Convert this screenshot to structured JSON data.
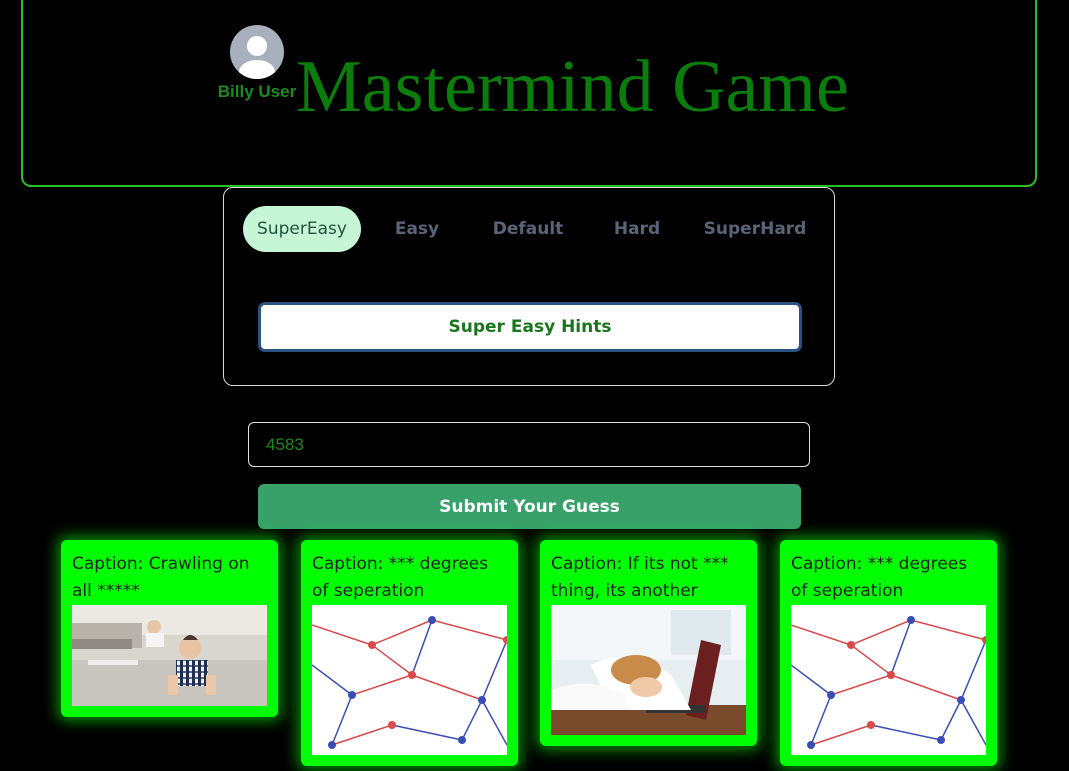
{
  "header": {
    "title": "Mastermind Game",
    "user": {
      "name": "Billy User",
      "avatar_icon": "user-avatar-icon"
    }
  },
  "difficulty": {
    "tabs": [
      {
        "label": "SuperEasy",
        "active": true
      },
      {
        "label": "Easy",
        "active": false
      },
      {
        "label": "Default",
        "active": false
      },
      {
        "label": "Hard",
        "active": false
      },
      {
        "label": "SuperHard",
        "active": false
      }
    ],
    "hints_button": "Super Easy Hints"
  },
  "guess": {
    "value": "4583",
    "submit_label": "Submit Your Guess"
  },
  "cards": [
    {
      "caption": "Caption: Crawling on all *****",
      "image": "baby-crawling-photo"
    },
    {
      "caption": "Caption: *** degrees of seperation",
      "image": "network-diagram-photo"
    },
    {
      "caption": "Caption: If its not *** thing, its another",
      "image": "tired-person-laptop-photo"
    },
    {
      "caption": "Caption: *** degrees of seperation",
      "image": "network-diagram-photo"
    }
  ],
  "colors": {
    "background": "#000000",
    "accent_green": "#00ff00",
    "title_green": "#0a7d0a",
    "submit_green": "#38a169",
    "active_tab_bg": "#c6f6d5"
  }
}
